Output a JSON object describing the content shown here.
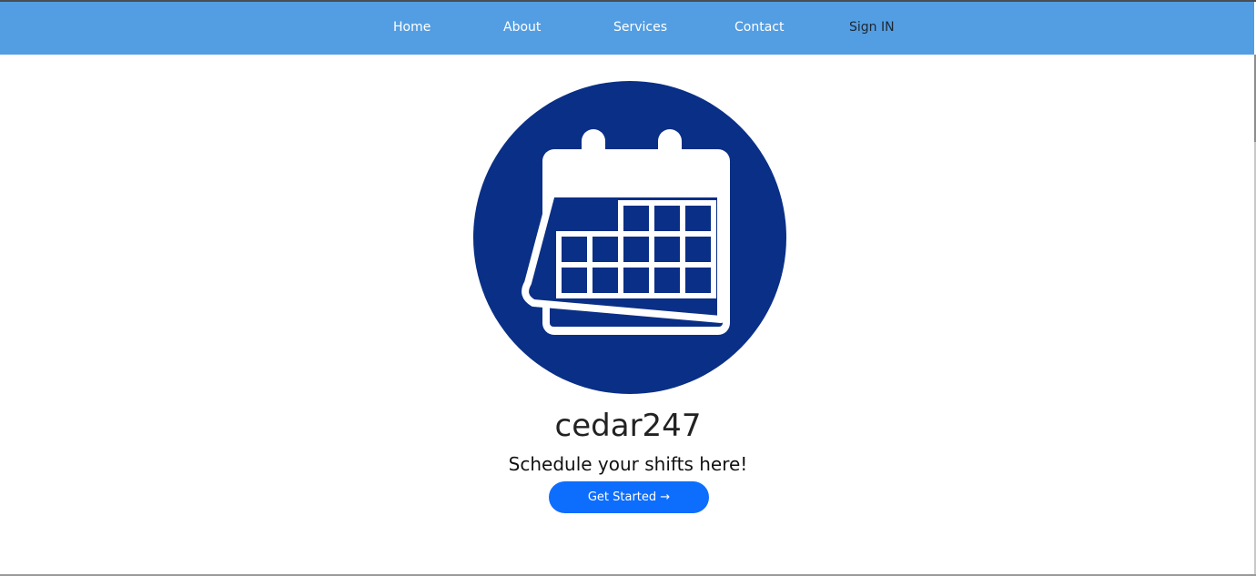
{
  "navbar": {
    "items": [
      {
        "label": "Home"
      },
      {
        "label": "About"
      },
      {
        "label": "Services"
      },
      {
        "label": "Contact"
      },
      {
        "label": "Sign IN"
      }
    ],
    "background": "#539ee2"
  },
  "hero": {
    "logo_icon": "calendar-icon",
    "logo_color": "#0a2f86",
    "title": "cedar247",
    "tagline": "Schedule your shifts here!",
    "cta_label": "Get Started →",
    "cta_color": "#0d6efd"
  }
}
